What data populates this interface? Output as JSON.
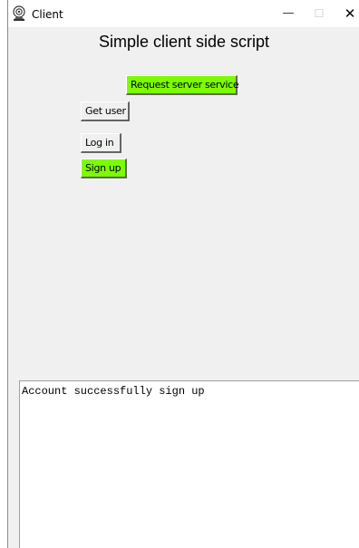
{
  "window": {
    "title": "Client",
    "minimize_glyph": "—",
    "maximize_glyph": "☐",
    "close_glyph": "✕",
    "icon": "webcam-app-icon"
  },
  "main": {
    "heading": "Simple client side script",
    "buttons": {
      "request_server_service": "Request server service",
      "get_user": "Get user",
      "log_in": "Log in",
      "sign_up": "Sign up"
    },
    "output_text": "Account successfully sign up"
  },
  "colors": {
    "accent_button": "#7cfc00",
    "window_background": "#f0f0f0",
    "output_background": "#ffffff"
  }
}
